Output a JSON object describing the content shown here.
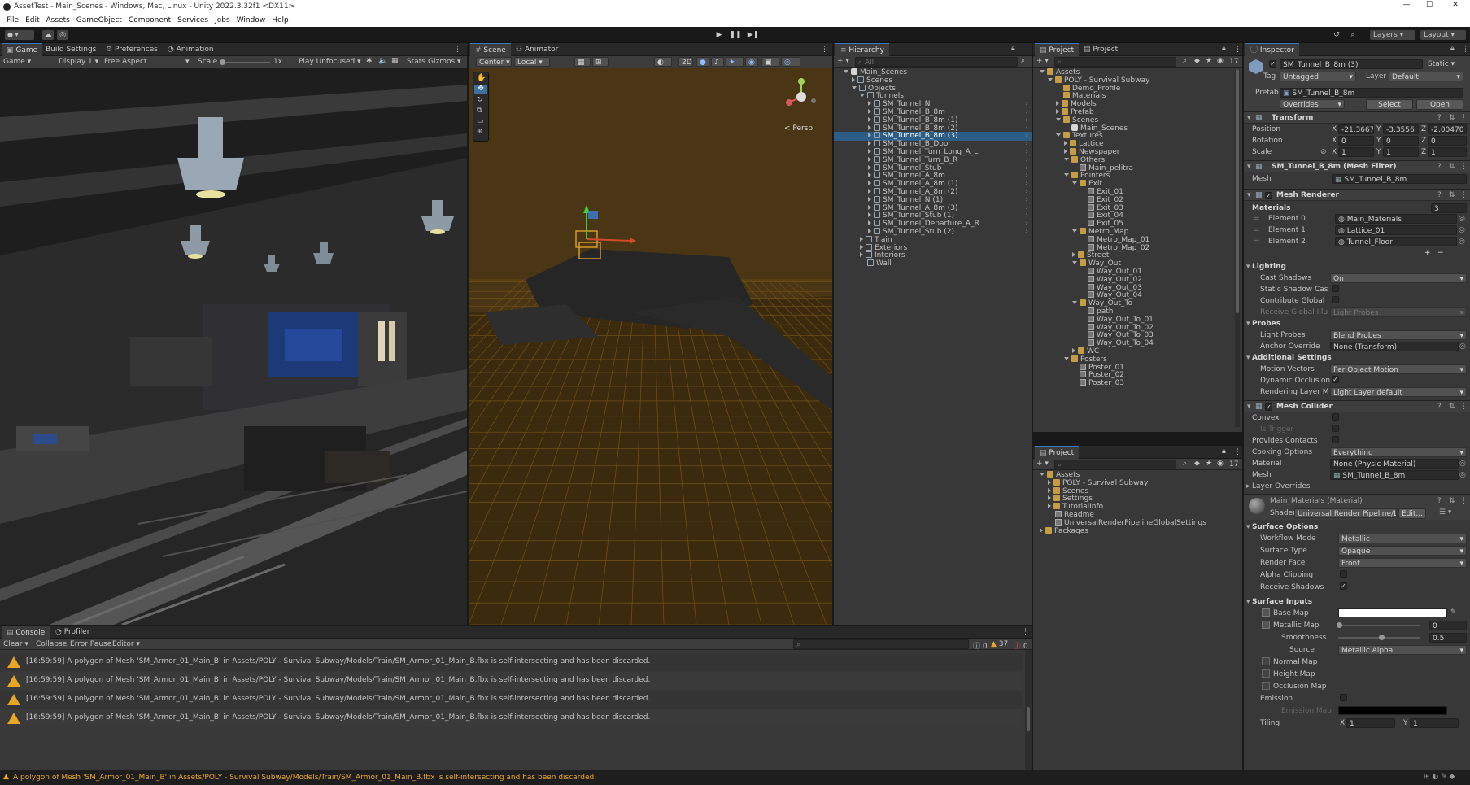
{
  "title": "AssetTest - Main_Scenes - Windows, Mac, Linux - Unity 2022.3.32f1 <DX11>",
  "menu": [
    "File",
    "Edit",
    "Assets",
    "GameObject",
    "Component",
    "Services",
    "Jobs",
    "Window",
    "Help"
  ],
  "toolbar": {
    "layers": "Layers",
    "layout": "Layout"
  },
  "game": {
    "tabs": [
      "Game",
      "Build Settings",
      "Preferences",
      "Animation"
    ],
    "display_mode": "Game",
    "display": "Display 1",
    "aspect": "Free Aspect",
    "scale_label": "Scale",
    "scale_value": "1x",
    "play_mode": "Play Unfocused",
    "stats": "Stats",
    "gizmos": "Gizmos"
  },
  "scene": {
    "tabs": [
      "Scene",
      "Animator"
    ],
    "pivot": "Center",
    "space": "Local",
    "mode2d": "2D",
    "persp": "< Persp"
  },
  "hierarchy": {
    "tab": "Hierarchy",
    "search": "All",
    "items": [
      {
        "l": "Main_Scenes",
        "i": 0,
        "t": "scene",
        "e": "down"
      },
      {
        "l": "Scenes",
        "i": 1,
        "t": "go",
        "e": "right"
      },
      {
        "l": "Objects",
        "i": 1,
        "t": "go",
        "e": "down"
      },
      {
        "l": "Tunnels",
        "i": 2,
        "t": "go",
        "e": "down"
      },
      {
        "l": "SM_Tunnel_N",
        "i": 3,
        "t": "go",
        "e": "right"
      },
      {
        "l": "SM_Tunnel_B_8m",
        "i": 3,
        "t": "go",
        "e": "right"
      },
      {
        "l": "SM_Tunnel_B_8m (1)",
        "i": 3,
        "t": "go",
        "e": "right"
      },
      {
        "l": "SM_Tunnel_B_8m (2)",
        "i": 3,
        "t": "go",
        "e": "right"
      },
      {
        "l": "SM_Tunnel_B_8m (3)",
        "i": 3,
        "t": "go",
        "e": "right",
        "sel": true
      },
      {
        "l": "SM_Tunnel_B_Door",
        "i": 3,
        "t": "go",
        "e": "right"
      },
      {
        "l": "SM_Tunnel_Turn_Long_A_L",
        "i": 3,
        "t": "go",
        "e": "right"
      },
      {
        "l": "SM_Tunnel_Turn_B_R",
        "i": 3,
        "t": "go",
        "e": "right"
      },
      {
        "l": "SM_Tunnel_Stub",
        "i": 3,
        "t": "go",
        "e": "right"
      },
      {
        "l": "SM_Tunnel_A_8m",
        "i": 3,
        "t": "go",
        "e": "right"
      },
      {
        "l": "SM_Tunnel_A_8m (1)",
        "i": 3,
        "t": "go",
        "e": "right"
      },
      {
        "l": "SM_Tunnel_A_8m (2)",
        "i": 3,
        "t": "go",
        "e": "right"
      },
      {
        "l": "SM_Tunnel_N (1)",
        "i": 3,
        "t": "go",
        "e": "right"
      },
      {
        "l": "SM_Tunnel_A_8m (3)",
        "i": 3,
        "t": "go",
        "e": "right"
      },
      {
        "l": "SM_Tunnel_Stub (1)",
        "i": 3,
        "t": "go",
        "e": "right"
      },
      {
        "l": "SM_Tunnel_Departure_A_R",
        "i": 3,
        "t": "go",
        "e": "right"
      },
      {
        "l": "SM_Tunnel_Stub (2)",
        "i": 3,
        "t": "go",
        "e": "right"
      },
      {
        "l": "Train",
        "i": 2,
        "t": "go",
        "e": "right"
      },
      {
        "l": "Exteriors",
        "i": 2,
        "t": "go",
        "e": "right"
      },
      {
        "l": "Interiors",
        "i": 2,
        "t": "go",
        "e": "right"
      },
      {
        "l": "Wall",
        "i": 2,
        "t": "go",
        "e": ""
      }
    ]
  },
  "project_top": {
    "tabs": [
      "Project",
      "Project"
    ],
    "count": "17",
    "items": [
      {
        "l": "Assets",
        "i": 0,
        "t": "folder",
        "e": "down"
      },
      {
        "l": "POLY - Survival Subway",
        "i": 1,
        "t": "folder",
        "e": "down"
      },
      {
        "l": "Demo_Profile",
        "i": 2,
        "t": "folder",
        "e": ""
      },
      {
        "l": "Materials",
        "i": 2,
        "t": "folder",
        "e": ""
      },
      {
        "l": "Models",
        "i": 2,
        "t": "folder",
        "e": "right"
      },
      {
        "l": "Prefab",
        "i": 2,
        "t": "folder",
        "e": "right"
      },
      {
        "l": "Scenes",
        "i": 2,
        "t": "folder",
        "e": "down"
      },
      {
        "l": "Main_Scenes",
        "i": 3,
        "t": "scene",
        "e": ""
      },
      {
        "l": "Textures",
        "i": 2,
        "t": "folder",
        "e": "down"
      },
      {
        "l": "Lattice",
        "i": 3,
        "t": "folder",
        "e": "right"
      },
      {
        "l": "Newspaper",
        "i": 3,
        "t": "folder",
        "e": "right"
      },
      {
        "l": "Others",
        "i": 3,
        "t": "folder",
        "e": "down"
      },
      {
        "l": "Main_pelitra",
        "i": 4,
        "t": "tex",
        "e": ""
      },
      {
        "l": "Pointers",
        "i": 3,
        "t": "folder",
        "e": "down"
      },
      {
        "l": "Exit",
        "i": 4,
        "t": "folder",
        "e": "down"
      },
      {
        "l": "Exit_01",
        "i": 5,
        "t": "tex",
        "e": ""
      },
      {
        "l": "Exit_02",
        "i": 5,
        "t": "tex",
        "e": ""
      },
      {
        "l": "Exit_03",
        "i": 5,
        "t": "tex",
        "e": ""
      },
      {
        "l": "Exit_04",
        "i": 5,
        "t": "tex",
        "e": ""
      },
      {
        "l": "Exit_05",
        "i": 5,
        "t": "tex",
        "e": ""
      },
      {
        "l": "Metro_Map",
        "i": 4,
        "t": "folder",
        "e": "down"
      },
      {
        "l": "Metro_Map_01",
        "i": 5,
        "t": "tex",
        "e": ""
      },
      {
        "l": "Metro_Map_02",
        "i": 5,
        "t": "tex",
        "e": ""
      },
      {
        "l": "Street",
        "i": 4,
        "t": "folder",
        "e": "right"
      },
      {
        "l": "Way_Out",
        "i": 4,
        "t": "folder",
        "e": "down"
      },
      {
        "l": "Way_Out_01",
        "i": 5,
        "t": "tex",
        "e": ""
      },
      {
        "l": "Way_Out_02",
        "i": 5,
        "t": "tex",
        "e": ""
      },
      {
        "l": "Way_Out_03",
        "i": 5,
        "t": "tex",
        "e": ""
      },
      {
        "l": "Way_Out_04",
        "i": 5,
        "t": "tex",
        "e": ""
      },
      {
        "l": "Way_Out_To",
        "i": 4,
        "t": "folder",
        "e": "down"
      },
      {
        "l": "path",
        "i": 5,
        "t": "tex",
        "e": ""
      },
      {
        "l": "Way_Out_To_01",
        "i": 5,
        "t": "tex",
        "e": ""
      },
      {
        "l": "Way_Out_To_02",
        "i": 5,
        "t": "tex",
        "e": ""
      },
      {
        "l": "Way_Out_To_03",
        "i": 5,
        "t": "tex",
        "e": ""
      },
      {
        "l": "Way_Out_To_04",
        "i": 5,
        "t": "tex",
        "e": ""
      },
      {
        "l": "WC",
        "i": 4,
        "t": "folder",
        "e": "right"
      },
      {
        "l": "Posters",
        "i": 3,
        "t": "folder",
        "e": "down"
      },
      {
        "l": "Poster_01",
        "i": 4,
        "t": "tex",
        "e": ""
      },
      {
        "l": "Poster_02",
        "i": 4,
        "t": "tex",
        "e": ""
      },
      {
        "l": "Poster_03",
        "i": 4,
        "t": "tex",
        "e": ""
      }
    ]
  },
  "project_bottom": {
    "tab": "Project",
    "count": "17",
    "items": [
      {
        "l": "Assets",
        "i": 0,
        "t": "folder",
        "e": "down"
      },
      {
        "l": "POLY - Survival Subway",
        "i": 1,
        "t": "folder",
        "e": "right"
      },
      {
        "l": "Scenes",
        "i": 1,
        "t": "folder",
        "e": "right"
      },
      {
        "l": "Settings",
        "i": 1,
        "t": "folder",
        "e": "right"
      },
      {
        "l": "TutorialInfo",
        "i": 1,
        "t": "folder",
        "e": "right"
      },
      {
        "l": "Readme",
        "i": 1,
        "t": "tex",
        "e": ""
      },
      {
        "l": "UniversalRenderPipelineGlobalSettings",
        "i": 1,
        "t": "tex",
        "e": ""
      },
      {
        "l": "Packages",
        "i": 0,
        "t": "folder",
        "e": "right"
      }
    ]
  },
  "inspector": {
    "tab": "Inspector",
    "name": "SM_Tunnel_B_8m (3)",
    "static": "Static",
    "tag_label": "Tag",
    "tag": "Untagged",
    "layer_label": "Layer",
    "layer": "Default",
    "prefab_label": "Prefab",
    "prefab": "SM_Tunnel_B_8m",
    "overrides": "Overrides",
    "select": "Select",
    "open": "Open",
    "transform": {
      "title": "Transform",
      "position": "Position",
      "rotation": "Rotation",
      "scale": "Scale",
      "pos": {
        "x": "-21.3667",
        "y": "-3.3556",
        "z": "-2.00470"
      },
      "rot": {
        "x": "0",
        "y": "0",
        "z": "0"
      },
      "scl": {
        "x": "1",
        "y": "1",
        "z": "1"
      }
    },
    "meshfilter": {
      "title": "SM_Tunnel_B_8m (Mesh Filter)",
      "mesh_label": "Mesh",
      "mesh": "SM_Tunnel_B_8m"
    },
    "renderer": {
      "title": "Mesh Renderer",
      "materials": "Materials",
      "count": "3",
      "elements": [
        {
          "k": "Element 0",
          "v": "Main_Materials"
        },
        {
          "k": "Element 1",
          "v": "Lattice_01"
        },
        {
          "k": "Element 2",
          "v": "Tunnel_Floor"
        }
      ],
      "lighting": "Lighting",
      "cast_shadows": "Cast Shadows",
      "cast_val": "On",
      "static_caster": "Static Shadow Caste",
      "contribute_gi": "Contribute Global Illu",
      "receive_gi": "Receive Global Illum",
      "receive_gi_val": "Light Probes",
      "probes": "Probes",
      "light_probes": "Light Probes",
      "light_probes_val": "Blend Probes",
      "anchor": "Anchor Override",
      "anchor_val": "None (Transform)",
      "additional": "Additional Settings",
      "motion": "Motion Vectors",
      "motion_val": "Per Object Motion",
      "occlusion": "Dynamic Occlusion",
      "layer_mask": "Rendering Layer Mas",
      "layer_mask_val": "Light Layer default"
    },
    "collider": {
      "title": "Mesh Collider",
      "convex": "Convex",
      "trigger": "Is Trigger",
      "contacts": "Provides Contacts",
      "cooking": "Cooking Options",
      "cooking_val": "Everything",
      "material": "Material",
      "material_val": "None (Physic Material)",
      "mesh": "Mesh",
      "mesh_val": "SM_Tunnel_B_8m",
      "layer_overrides": "Layer Overrides"
    },
    "material": {
      "title": "Main_Materials (Material)",
      "shader_label": "Shader",
      "shader": "Universal Render Pipeline/Lit",
      "edit": "Edit...",
      "surface_options": "Surface Options",
      "workflow": "Workflow Mode",
      "workflow_val": "Metallic",
      "surface_type": "Surface Type",
      "surface_type_val": "Opaque",
      "render_face": "Render Face",
      "render_face_val": "Front",
      "alpha_clip": "Alpha Clipping",
      "receive_shadows": "Receive Shadows",
      "surface_inputs": "Surface Inputs",
      "base_map": "Base Map",
      "metallic_map": "Metallic Map",
      "metallic_val": "0",
      "smoothness": "Smoothness",
      "smooth_val": "0.5",
      "source": "Source",
      "source_val": "Metallic Alpha",
      "normal": "Normal Map",
      "height": "Height Map",
      "occl_map": "Occlusion Map",
      "emission": "Emission",
      "emission_map": "Emission Map",
      "tiling": "Tiling",
      "tiling_x": "1",
      "tiling_y": "1"
    }
  },
  "console": {
    "tabs": [
      "Console",
      "Profiler"
    ],
    "clear": "Clear",
    "collapse": "Collapse",
    "error_pause": "Error Pause",
    "editor": "Editor",
    "counts": {
      "info": "0",
      "warn": "37",
      "error": "0"
    },
    "logs": [
      "[16:59:59] A polygon of Mesh 'SM_Armor_01_Main_B' in Assets/POLY - Survival Subway/Models/Train/SM_Armor_01_Main_B.fbx is self-intersecting and has been discarded.",
      "[16:59:59] A polygon of Mesh 'SM_Armor_01_Main_B' in Assets/POLY - Survival Subway/Models/Train/SM_Armor_01_Main_B.fbx is self-intersecting and has been discarded.",
      "[16:59:59] A polygon of Mesh 'SM_Armor_01_Main_B' in Assets/POLY - Survival Subway/Models/Train/SM_Armor_01_Main_B.fbx is self-intersecting and has been discarded.",
      "[16:59:59] A polygon of Mesh 'SM_Armor_01_Main_B' in Assets/POLY - Survival Subway/Models/Train/SM_Armor_01_Main_B.fbx is self-intersecting and has been discarded."
    ]
  },
  "status": "A polygon of Mesh 'SM_Armor_01_Main_B' in Assets/POLY - Survival Subway/Models/Train/SM_Armor_01_Main_B.fbx is self-intersecting and has been discarded.",
  "colors": {
    "selection": "#2c5d87",
    "warning": "#e8a625",
    "folder": "#c59d45",
    "grid": "#c07a1a"
  }
}
